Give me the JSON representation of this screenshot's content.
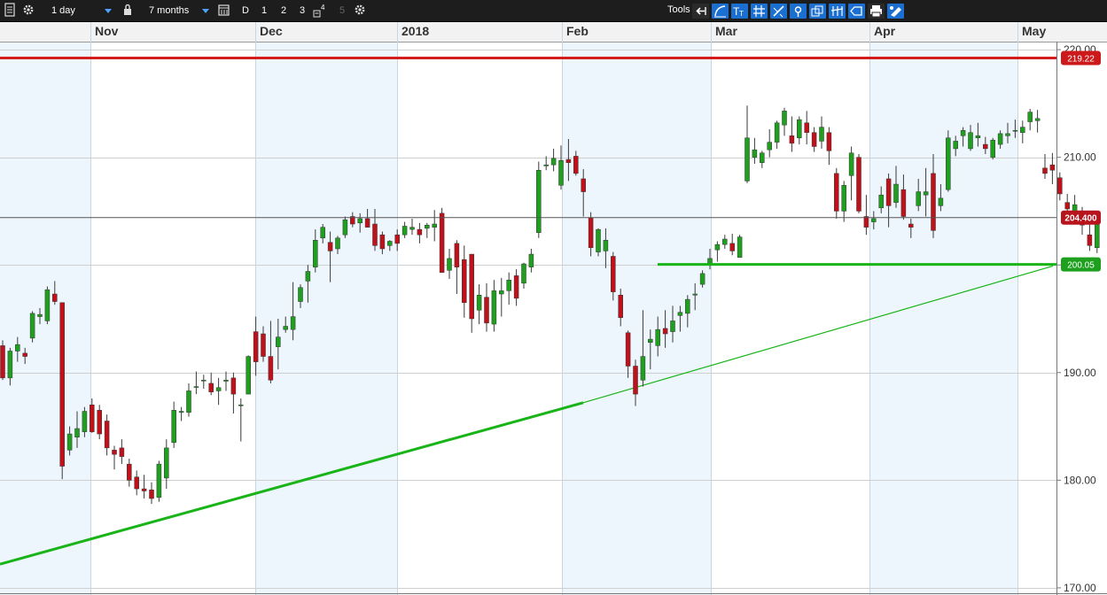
{
  "toolbar": {
    "interval": "1 day",
    "range": "7 months",
    "quick_buttons": [
      "D",
      "1",
      "2",
      "3"
    ],
    "superscript": "4",
    "dim_button": "5",
    "tools_label": "Tools"
  },
  "chart_data": {
    "type": "candlestick",
    "x_labels": [
      "Nov",
      "Dec",
      "2018",
      "Feb",
      "Mar",
      "Apr",
      "May"
    ],
    "y_ticks": [
      "170.00",
      "180.00",
      "190.00",
      "200.00",
      "210.00",
      "220.00"
    ],
    "ylim": [
      169.5,
      220.5
    ],
    "grid": true,
    "colors": {
      "up": "#1ea01e",
      "down": "#c0101a",
      "resistance": "#d41c1c",
      "support": "#18b418",
      "last": "#555555"
    },
    "horizontal_lines": [
      {
        "label": "219.22",
        "value": 219.22,
        "kind": "resistance"
      },
      {
        "label": "204.400",
        "value": 204.4,
        "kind": "last"
      },
      {
        "label": "200.05",
        "value": 200.05,
        "kind": "support"
      }
    ],
    "candles": [
      [
        192.5,
        193.0,
        189.3,
        189.5
      ],
      [
        189.5,
        192.3,
        188.8,
        192.0
      ],
      [
        192.0,
        193.3,
        191.0,
        192.6
      ],
      [
        191.8,
        192.3,
        190.8,
        191.5
      ],
      [
        193.2,
        195.7,
        192.8,
        195.5
      ],
      [
        195.2,
        196.0,
        194.5,
        195.4
      ],
      [
        194.8,
        198.0,
        194.5,
        197.7
      ],
      [
        197.3,
        198.5,
        196.3,
        196.6
      ],
      [
        196.5,
        186.9,
        180.1,
        181.3
      ],
      [
        182.8,
        185.0,
        182.3,
        184.3
      ],
      [
        184.0,
        186.4,
        183.0,
        184.8
      ],
      [
        184.5,
        186.8,
        184.0,
        186.4
      ],
      [
        187.0,
        187.6,
        184.4,
        184.5
      ],
      [
        186.5,
        187.0,
        183.8,
        184.3
      ],
      [
        185.5,
        186.1,
        182.3,
        183.0
      ],
      [
        182.8,
        183.2,
        181.0,
        182.4
      ],
      [
        183.0,
        183.8,
        181.5,
        182.2
      ],
      [
        181.5,
        182.0,
        179.4,
        180.0
      ],
      [
        180.3,
        180.9,
        178.6,
        179.2
      ],
      [
        179.2,
        180.5,
        178.3,
        179.0
      ],
      [
        179.1,
        179.8,
        177.8,
        178.3
      ],
      [
        178.4,
        181.8,
        178.0,
        181.5
      ],
      [
        180.2,
        183.8,
        179.2,
        183.0
      ],
      [
        183.5,
        187.3,
        183.0,
        186.5
      ],
      [
        186.3,
        186.8,
        185.5,
        186.4
      ],
      [
        186.3,
        189.0,
        185.9,
        188.3
      ],
      [
        188.7,
        190.1,
        188.0,
        188.7
      ],
      [
        189.3,
        189.8,
        188.5,
        189.3
      ],
      [
        189.0,
        190.0,
        187.9,
        188.2
      ],
      [
        188.3,
        189.5,
        187.0,
        188.6
      ],
      [
        189.2,
        190.1,
        188.3,
        189.3
      ],
      [
        189.5,
        190.0,
        186.2,
        188.0
      ],
      [
        187.0,
        187.6,
        183.6,
        187.0
      ],
      [
        188.0,
        191.6,
        188.0,
        191.5
      ],
      [
        193.8,
        195.2,
        189.7,
        191.0
      ],
      [
        193.6,
        194.3,
        191.0,
        191.5
      ],
      [
        191.5,
        194.8,
        189.0,
        189.3
      ],
      [
        192.4,
        195.0,
        190.3,
        193.3
      ],
      [
        194.0,
        195.2,
        193.7,
        194.3
      ],
      [
        194.0,
        198.4,
        193.0,
        195.2
      ],
      [
        196.6,
        198.2,
        196.0,
        197.9
      ],
      [
        198.5,
        200.0,
        196.5,
        199.4
      ],
      [
        199.8,
        203.3,
        199.3,
        202.3
      ],
      [
        202.5,
        203.8,
        202.0,
        203.5
      ],
      [
        202.1,
        203.1,
        198.4,
        201.3
      ],
      [
        201.5,
        202.7,
        201.0,
        202.5
      ],
      [
        202.8,
        204.5,
        202.5,
        204.2
      ],
      [
        204.5,
        204.9,
        203.5,
        203.8
      ],
      [
        203.9,
        204.8,
        203.0,
        204.3
      ],
      [
        204.3,
        205.2,
        203.5,
        203.5
      ],
      [
        203.8,
        205.2,
        201.3,
        201.8
      ],
      [
        202.8,
        203.1,
        201.0,
        201.5
      ],
      [
        201.8,
        202.3,
        201.3,
        202.2
      ],
      [
        202.8,
        203.3,
        201.3,
        202.0
      ],
      [
        202.8,
        204.0,
        202.5,
        203.6
      ],
      [
        203.3,
        204.3,
        202.8,
        203.5
      ],
      [
        203.3,
        203.9,
        202.0,
        202.8
      ],
      [
        203.4,
        203.9,
        202.5,
        203.7
      ],
      [
        203.5,
        205.1,
        202.2,
        203.8
      ],
      [
        204.8,
        205.3,
        202.0,
        199.3
      ],
      [
        199.5,
        201.5,
        198.7,
        200.6
      ],
      [
        202.0,
        202.3,
        197.3,
        199.8
      ],
      [
        200.5,
        201.8,
        195.1,
        196.5
      ],
      [
        201.0,
        200.4,
        193.7,
        195.0
      ],
      [
        195.8,
        198.2,
        194.5,
        197.2
      ],
      [
        197.0,
        198.3,
        193.8,
        194.6
      ],
      [
        194.5,
        198.6,
        193.8,
        197.6
      ],
      [
        197.3,
        198.8,
        195.2,
        197.6
      ],
      [
        197.6,
        199.3,
        196.3,
        198.6
      ],
      [
        199.0,
        199.6,
        196.2,
        196.9
      ],
      [
        198.3,
        200.2,
        197.8,
        200.1
      ],
      [
        199.8,
        201.5,
        199.3,
        201.0
      ],
      [
        203.0,
        209.6,
        202.5,
        208.8
      ],
      [
        209.2,
        210.1,
        208.8,
        209.3
      ],
      [
        209.3,
        210.8,
        208.7,
        209.9
      ],
      [
        207.4,
        211.1,
        207.0,
        209.7
      ],
      [
        209.8,
        211.7,
        207.8,
        209.5
      ],
      [
        210.1,
        210.6,
        208.3,
        208.5
      ],
      [
        208.0,
        208.9,
        204.5,
        206.8
      ],
      [
        204.4,
        204.9,
        200.8,
        201.6
      ],
      [
        201.2,
        203.4,
        200.8,
        203.3
      ],
      [
        201.3,
        203.4,
        199.7,
        202.3
      ],
      [
        200.8,
        201.2,
        196.7,
        197.5
      ],
      [
        197.2,
        197.8,
        194.3,
        195.1
      ],
      [
        193.7,
        193.9,
        189.5,
        190.6
      ],
      [
        190.6,
        191.2,
        186.9,
        188.0
      ],
      [
        189.3,
        195.8,
        188.7,
        191.5
      ],
      [
        192.8,
        194.0,
        190.3,
        193.1
      ],
      [
        192.5,
        195.2,
        191.5,
        194.0
      ],
      [
        194.1,
        195.8,
        192.3,
        193.6
      ],
      [
        193.8,
        196.2,
        192.8,
        194.8
      ],
      [
        195.3,
        196.2,
        193.8,
        195.6
      ],
      [
        195.5,
        197.2,
        194.2,
        196.8
      ],
      [
        197.2,
        198.3,
        195.8,
        197.3
      ],
      [
        198.2,
        199.5,
        197.9,
        199.2
      ],
      [
        200.1,
        201.5,
        199.6,
        200.6
      ],
      [
        201.4,
        202.2,
        200.3,
        201.9
      ],
      [
        201.9,
        202.8,
        201.5,
        202.4
      ],
      [
        202.0,
        202.9,
        200.9,
        201.3
      ],
      [
        200.7,
        202.8,
        200.7,
        202.6
      ],
      [
        207.8,
        214.8,
        207.6,
        211.8
      ],
      [
        210.0,
        211.8,
        209.4,
        210.7
      ],
      [
        209.5,
        210.6,
        209.0,
        210.4
      ],
      [
        210.7,
        212.6,
        210.0,
        211.4
      ],
      [
        211.4,
        213.4,
        210.8,
        213.2
      ],
      [
        213.0,
        214.6,
        212.0,
        214.3
      ],
      [
        212.0,
        213.8,
        210.5,
        211.3
      ],
      [
        211.8,
        213.8,
        211.2,
        213.5
      ],
      [
        213.2,
        214.3,
        211.2,
        212.3
      ],
      [
        212.3,
        212.8,
        210.5,
        211.0
      ],
      [
        211.5,
        213.8,
        210.8,
        212.8
      ],
      [
        212.3,
        212.8,
        209.3,
        210.6
      ],
      [
        208.5,
        209.0,
        204.3,
        205.0
      ],
      [
        205.0,
        207.8,
        204.0,
        207.4
      ],
      [
        208.3,
        211.0,
        206.0,
        210.4
      ],
      [
        210.0,
        210.3,
        204.8,
        205.0
      ],
      [
        204.5,
        206.5,
        202.8,
        203.5
      ],
      [
        204.0,
        205.0,
        203.3,
        204.3
      ],
      [
        205.3,
        207.3,
        204.8,
        206.5
      ],
      [
        208.0,
        208.5,
        203.5,
        205.5
      ],
      [
        205.8,
        209.2,
        205.3,
        207.5
      ],
      [
        207.0,
        208.4,
        204.2,
        204.5
      ],
      [
        203.8,
        204.3,
        202.5,
        203.5
      ],
      [
        205.5,
        208.0,
        205.0,
        206.8
      ],
      [
        206.5,
        209.0,
        204.5,
        206.8
      ],
      [
        208.5,
        210.3,
        202.5,
        203.2
      ],
      [
        205.5,
        207.5,
        205.0,
        206.2
      ],
      [
        207.0,
        212.5,
        206.8,
        211.8
      ],
      [
        210.8,
        212.0,
        210.1,
        211.5
      ],
      [
        212.0,
        212.8,
        211.0,
        212.5
      ],
      [
        210.8,
        213.0,
        210.6,
        212.3
      ],
      [
        211.8,
        213.2,
        211.0,
        212.0
      ],
      [
        211.2,
        211.9,
        210.3,
        210.8
      ],
      [
        210.0,
        211.8,
        209.8,
        211.6
      ],
      [
        211.2,
        212.5,
        210.8,
        212.2
      ],
      [
        212.0,
        213.2,
        211.3,
        212.2
      ],
      [
        212.5,
        213.5,
        211.8,
        212.5
      ],
      [
        212.3,
        213.4,
        211.3,
        212.8
      ],
      [
        213.3,
        214.5,
        212.5,
        214.2
      ],
      [
        213.4,
        214.4,
        212.3,
        213.6
      ],
      [
        209.0,
        210.3,
        208.0,
        208.5
      ],
      [
        209.3,
        210.4,
        207.5,
        208.8
      ],
      [
        208.1,
        208.6,
        206.0,
        206.6
      ],
      [
        205.8,
        206.6,
        204.0,
        205.2
      ],
      [
        205.0,
        206.5,
        204.3,
        205.6
      ],
      [
        204.2,
        205.4,
        202.8,
        203.7
      ],
      [
        202.8,
        204.0,
        201.3,
        201.8
      ],
      [
        201.6,
        204.8,
        201.1,
        204.3
      ]
    ]
  }
}
